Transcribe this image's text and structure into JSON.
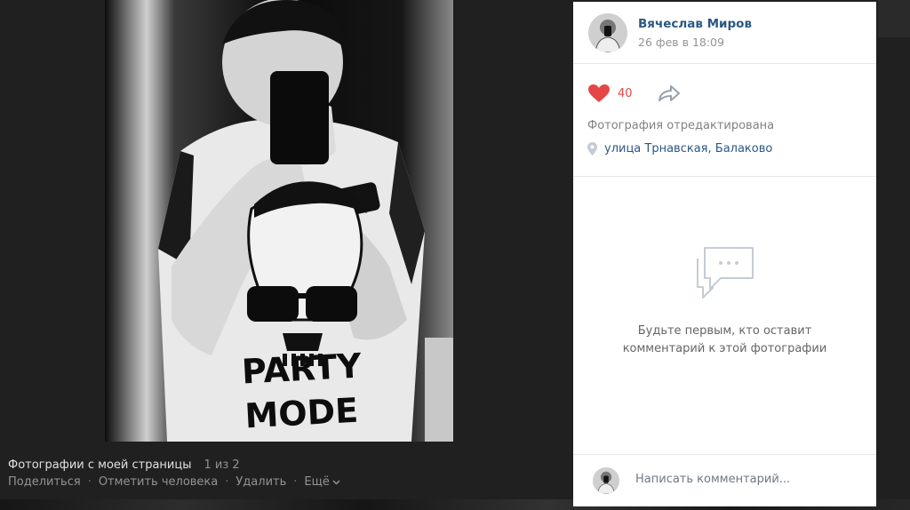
{
  "photo_info": {
    "album_title": "Фотографии с моей страницы",
    "counter": "1 из 2",
    "actions": {
      "share": "Поделиться",
      "tag_person": "Отметить человека",
      "delete": "Удалить",
      "more": "Ещё"
    }
  },
  "photo_print": {
    "line1": "PARTY",
    "line2": "MODE"
  },
  "panel": {
    "author_name": "Вячеслав Миров",
    "date": "26 фев в 18:09",
    "likes": "40",
    "edited_note": "Фотография отредактирована",
    "location": "улица Трнавская, Балаково",
    "empty_comments_line1": "Будьте первым, кто оставит",
    "empty_comments_line2": "комментарий к этой фотографии",
    "comment_placeholder": "Написать комментарий..."
  },
  "colors": {
    "link": "#2a5885",
    "like": "#e64646",
    "muted": "#939393",
    "panel_bg": "#ffffff",
    "backdrop": "#202020"
  },
  "icons": {
    "like": "heart-icon",
    "share": "share-arrow-icon",
    "location": "location-pin-icon",
    "comments": "chat-bubble-icon",
    "more": "chevron-down-icon"
  }
}
